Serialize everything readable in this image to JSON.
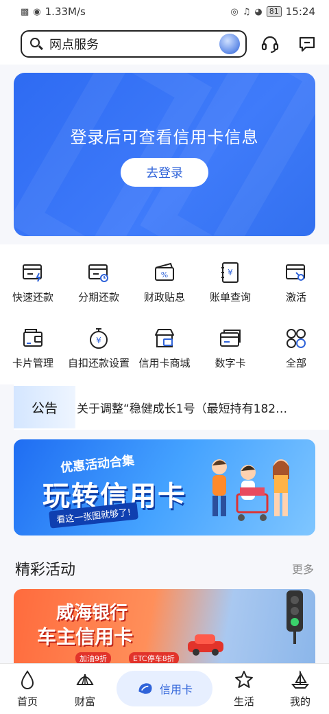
{
  "status_bar": {
    "speed": "1.33M/s",
    "battery": "81",
    "time": "15:24"
  },
  "header": {
    "search_text": "网点服务",
    "icons": [
      "headset-icon",
      "message-icon"
    ]
  },
  "login_card": {
    "title": "登录后可查看信用卡信息",
    "button": "去登录"
  },
  "grid": {
    "items": [
      {
        "label": "快速还款",
        "icon": "fast-repay-icon"
      },
      {
        "label": "分期还款",
        "icon": "installment-icon"
      },
      {
        "label": "财政贴息",
        "icon": "subsidy-icon"
      },
      {
        "label": "账单查询",
        "icon": "bill-icon"
      },
      {
        "label": "激活",
        "icon": "activate-icon"
      },
      {
        "label": "卡片管理",
        "icon": "wallet-icon"
      },
      {
        "label": "自扣还款设置",
        "icon": "auto-repay-icon"
      },
      {
        "label": "信用卡商城",
        "icon": "store-icon"
      },
      {
        "label": "数字卡",
        "icon": "digital-card-icon"
      },
      {
        "label": "全部",
        "icon": "all-icon"
      }
    ]
  },
  "notice": {
    "tag": "公告",
    "text": "关于调整“稳健成长1号（最短持有182…"
  },
  "promo": {
    "subtitle": "优惠活动合集",
    "title": "玩转信用卡",
    "tagline": "看这一张图就够了!"
  },
  "activities": {
    "title": "精彩活动",
    "more": "更多",
    "banner_line1": "威海银行",
    "banner_line2": "车主信用卡",
    "chip1": "加油9折",
    "chip2": "ETC停车8折"
  },
  "bottom_nav": {
    "items": [
      {
        "label": "首页",
        "icon": "home-icon"
      },
      {
        "label": "财富",
        "icon": "wealth-icon"
      },
      {
        "label": "信用卡",
        "icon": "credit-card-icon",
        "active": true
      },
      {
        "label": "生活",
        "icon": "life-icon"
      },
      {
        "label": "我的",
        "icon": "profile-icon"
      }
    ]
  },
  "colors": {
    "accent": "#2f63d9",
    "banner_blue": "#3f7bfa"
  }
}
